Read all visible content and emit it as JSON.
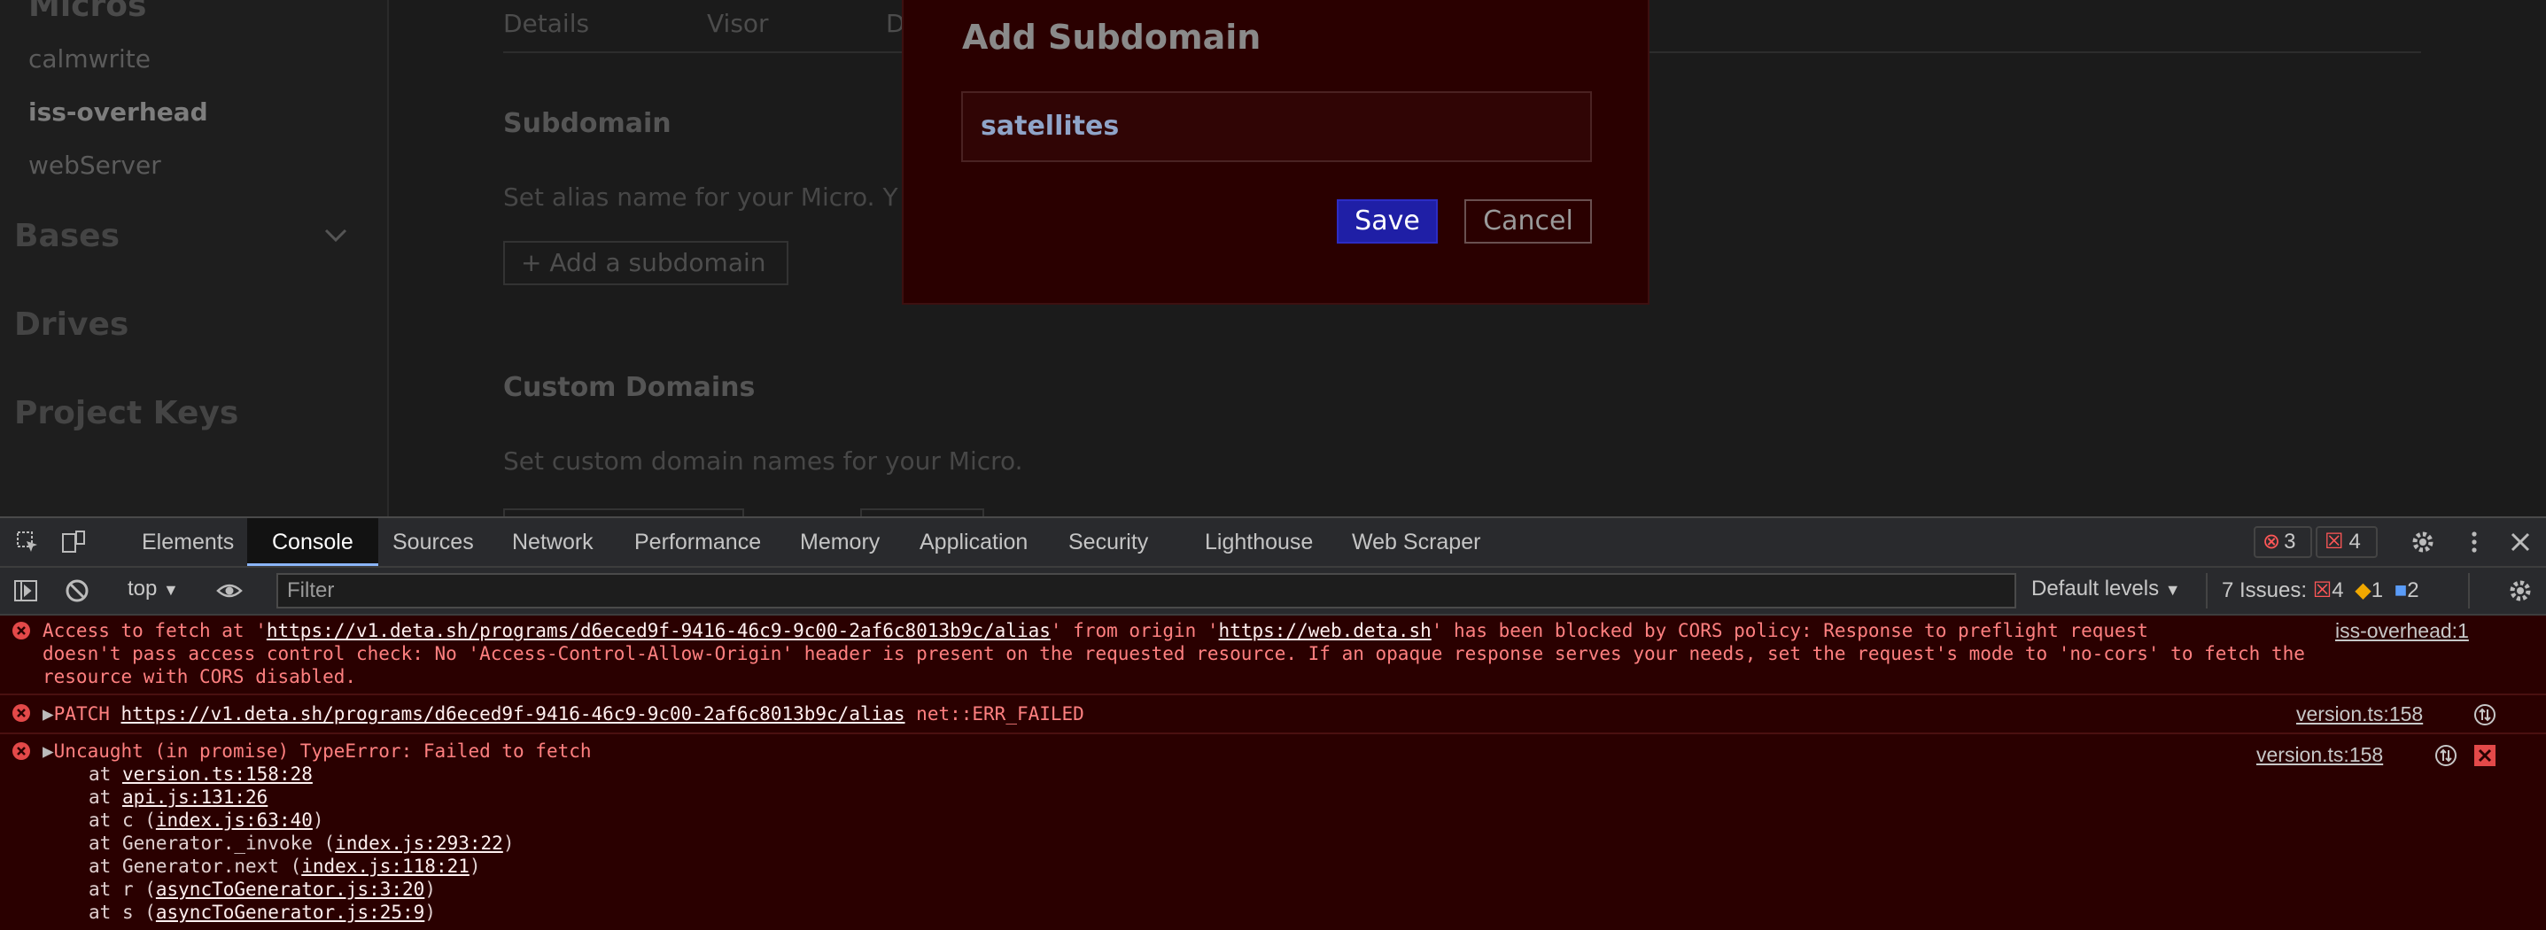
{
  "sidebar": {
    "items": [
      "calmwrite",
      "iss-overhead",
      "webServer"
    ],
    "active_item": "iss-overhead",
    "sections": [
      "Bases",
      "Drives",
      "Project Keys"
    ]
  },
  "main": {
    "tabs": [
      "Details",
      "Visor",
      "D"
    ],
    "subdomain": {
      "title": "Subdomain",
      "description": "Set alias name for your Micro. Y",
      "add_button": "+ Add a subdomain"
    },
    "custom_domains": {
      "title": "Custom Domains",
      "description": "Set custom domain names for your Micro."
    }
  },
  "modal": {
    "title": "Add Subdomain",
    "input_value": "satellites",
    "save_label": "Save",
    "cancel_label": "Cancel"
  },
  "devtools": {
    "tabs": [
      "Elements",
      "Console",
      "Sources",
      "Network",
      "Performance",
      "Memory",
      "Application",
      "Security",
      "Lighthouse",
      "Web Scraper"
    ],
    "active_tab": "Console",
    "error_badge": "3",
    "issue_badge": "4",
    "context": "top",
    "filter_placeholder": "Filter",
    "levels": "Default levels",
    "issues": {
      "label": "7 Issues:",
      "errors": "4",
      "warnings": "1",
      "info": "2"
    },
    "messages": [
      {
        "line1_pre": "Access to fetch at '",
        "line1_link": "https://v1.deta.sh/programs/d6eced9f-9416-46c9-9c00-2af6c8013b9c/alias",
        "line1_mid": "' from origin '",
        "line1_link2": "https://web.deta.sh",
        "line1_post": "' has been blocked by CORS policy: Response to preflight request",
        "line2": "doesn't pass access control check: No 'Access-Control-Allow-Origin' header is present on the requested resource. If an opaque response serves your needs, set the request's mode to 'no-cors' to fetch the",
        "line3": "resource with CORS disabled.",
        "source": "iss-overhead:1"
      },
      {
        "prefix": "PATCH ",
        "link": "https://v1.deta.sh/programs/d6eced9f-9416-46c9-9c00-2af6c8013b9c/alias",
        "suffix": " net::ERR_FAILED",
        "source": "version.ts:158"
      },
      {
        "text": "Uncaught (in promise) TypeError: Failed to fetch",
        "source": "version.ts:158",
        "stack": [
          {
            "pre": "at ",
            "fn": "",
            "link": "version.ts:158:28"
          },
          {
            "pre": "at ",
            "fn": "",
            "link": "api.js:131:26"
          },
          {
            "pre": "at ",
            "fn": "c (",
            "link": "index.js:63:40"
          },
          {
            "pre": "at ",
            "fn": "Generator._invoke (",
            "link": "index.js:293:22"
          },
          {
            "pre": "at ",
            "fn": "Generator.next (",
            "link": "index.js:118:21"
          },
          {
            "pre": "at ",
            "fn": "r (",
            "link": "asyncToGenerator.js:3:20"
          },
          {
            "pre": "at ",
            "fn": "s (",
            "link": "asyncToGenerator.js:25:9"
          }
        ]
      }
    ]
  }
}
